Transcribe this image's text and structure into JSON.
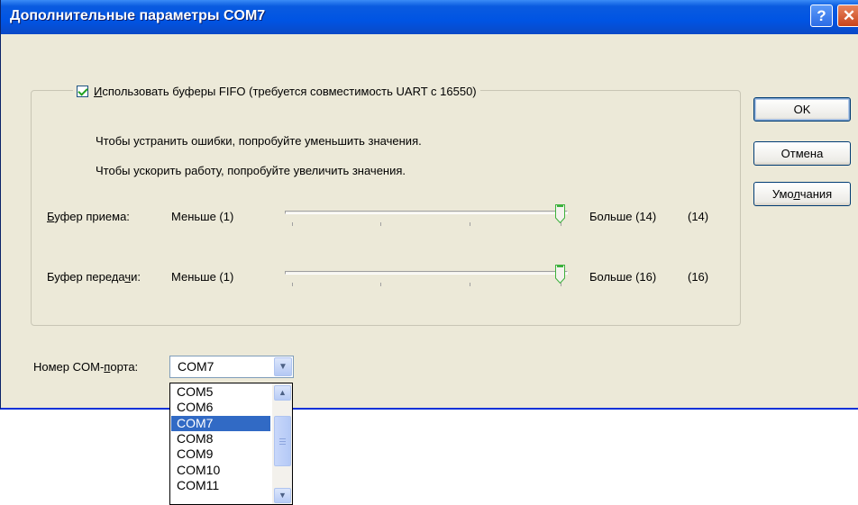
{
  "window": {
    "title": "Дополнительные параметры COM7",
    "help_label": "?",
    "close_label": "✕"
  },
  "fifo": {
    "checkbox_checked": true,
    "checkbox_label_underlined": "И",
    "checkbox_label_rest": "спользовать буферы FIFO (требуется совместимость UART с 16550)",
    "hint_errors": "Чтобы устранить ошибки, попробуйте уменьшить значения.",
    "hint_speed": "Чтобы ускорить работу, попробуйте увеличить значения."
  },
  "receive_buffer": {
    "label_underlined": "Б",
    "label_rest": "уфер приема:",
    "min_label": "Меньше (1)",
    "max_label": "Больше (14)",
    "value_label": "(14)",
    "value": 14,
    "min": 1,
    "max": 14
  },
  "transmit_buffer": {
    "label_before": "Буфер переда",
    "label_underlined": "ч",
    "label_after": "и:",
    "min_label": "Меньше (1)",
    "max_label": "Больше (16)",
    "value_label": "(16)",
    "value": 16,
    "min": 1,
    "max": 16
  },
  "buttons": {
    "ok": "OK",
    "cancel": "Отмена",
    "defaults_before": "Умо",
    "defaults_underlined": "л",
    "defaults_after": "чания"
  },
  "com_port": {
    "label_before": "Номер COM-",
    "label_underlined": "п",
    "label_after": "орта:",
    "selected": "COM7",
    "options": [
      "COM5",
      "COM6",
      "COM7",
      "COM8",
      "COM9",
      "COM10",
      "COM11"
    ],
    "selected_index": 2
  },
  "colors": {
    "titlebar": "#0054E3",
    "dialog_bg": "#ECE9D8",
    "selection": "#316AC5",
    "check": "#21A121",
    "slider_thumb": "#3DB13D"
  },
  "icons": {
    "help": "question-mark-icon",
    "close": "close-x-icon",
    "dropdown": "chevron-down-icon",
    "scroll_up": "chevron-up-icon",
    "scroll_down": "chevron-down-icon"
  }
}
